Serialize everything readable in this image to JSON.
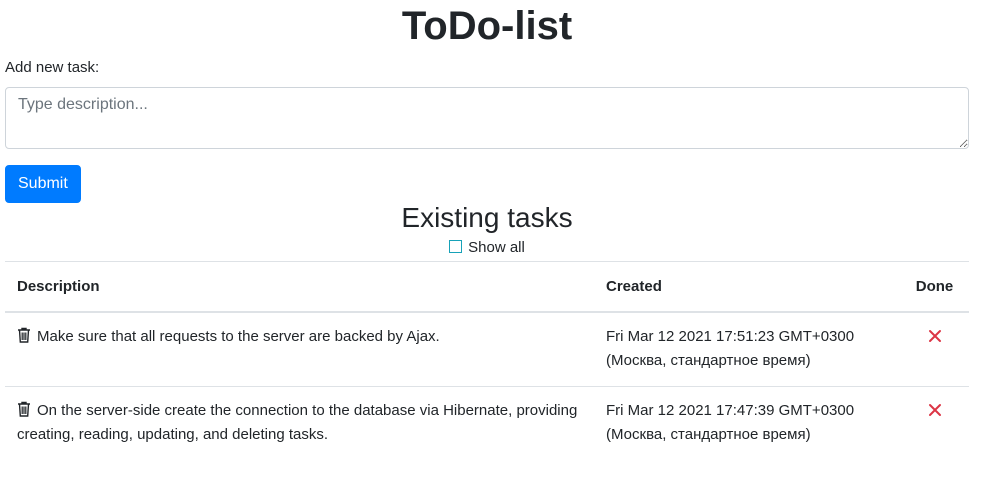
{
  "page": {
    "title": "ToDo-list"
  },
  "form": {
    "label": "Add new task:",
    "placeholder": "Type description...",
    "value": "",
    "submit_label": "Submit"
  },
  "tasks_section": {
    "title": "Existing tasks",
    "show_all_label": "Show all",
    "show_all_checked": false,
    "columns": {
      "description": "Description",
      "created": "Created",
      "done": "Done"
    },
    "rows": [
      {
        "description": "Make sure that all requests to the server are backed by Ajax.",
        "created": "Fri Mar 12 2021 17:51:23 GMT+0300 (Москва, стандартное время)",
        "done_icon": "x-mark-icon"
      },
      {
        "description": "On the server-side create the connection to the database via Hibernate, providing creating, reading, updating, and deleting tasks.",
        "created": "Fri Mar 12 2021 17:47:39 GMT+0300 (Москва, стандартное время)",
        "done_icon": "x-mark-icon"
      }
    ]
  },
  "colors": {
    "primary": "#007bff",
    "danger": "#dc3545",
    "checkbox_border": "#17a2b8"
  }
}
